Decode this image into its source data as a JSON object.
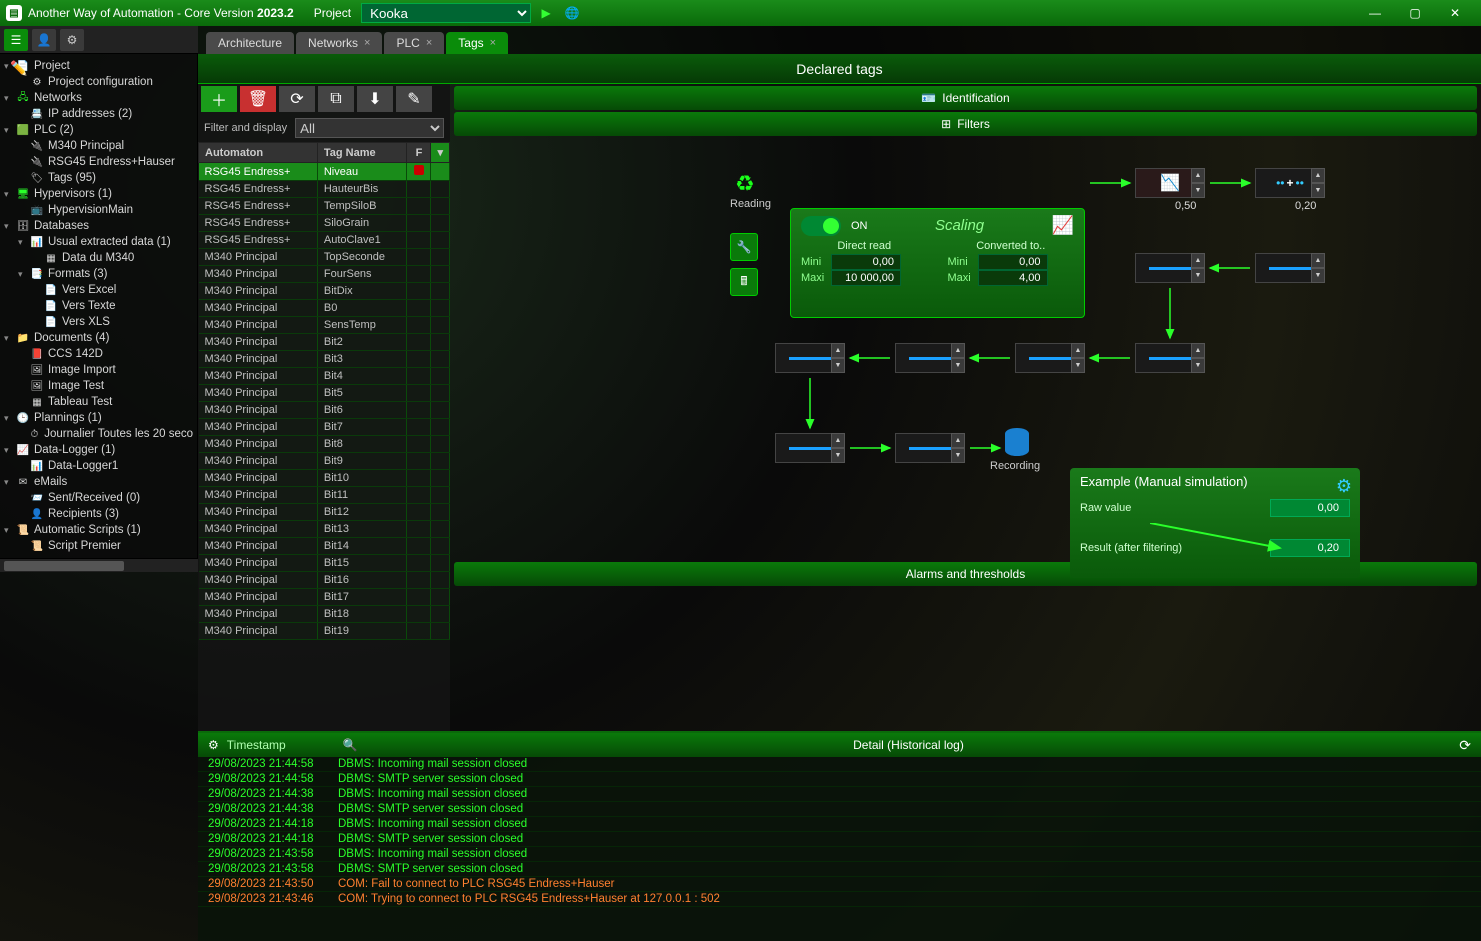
{
  "app": {
    "title_prefix": "Another Way of Automation - Core Version",
    "version": "2023.2",
    "project_label": "Project",
    "project_selected": "Kooka"
  },
  "tabs": [
    {
      "label": "Architecture",
      "closable": false,
      "active": false
    },
    {
      "label": "Networks",
      "closable": true,
      "active": false
    },
    {
      "label": "PLC",
      "closable": true,
      "active": false
    },
    {
      "label": "Tags",
      "closable": true,
      "active": true
    }
  ],
  "tree": [
    {
      "label": "Project",
      "icon": "📄",
      "indent": 0,
      "toggle": "▾"
    },
    {
      "label": "Project configuration",
      "icon": "⚙",
      "indent": 1
    },
    {
      "label": "Networks",
      "icon": "🖧",
      "indent": 0,
      "toggle": "▾",
      "iconColor": "#2aff2a"
    },
    {
      "label": "IP addresses (2)",
      "icon": "📇",
      "indent": 1
    },
    {
      "label": "PLC (2)",
      "icon": "🟩",
      "indent": 0,
      "toggle": "▾"
    },
    {
      "label": "M340 Principal",
      "icon": "🔌",
      "indent": 1
    },
    {
      "label": "RSG45 Endress+Hauser",
      "icon": "🔌",
      "indent": 1
    },
    {
      "label": "Tags (95)",
      "icon": "🏷",
      "indent": 1
    },
    {
      "label": "Hypervisors (1)",
      "icon": "🖥",
      "indent": 0,
      "toggle": "▾",
      "iconColor": "#2aff2a"
    },
    {
      "label": "HypervisionMain",
      "icon": "📺",
      "indent": 1
    },
    {
      "label": "Databases",
      "icon": "🗄",
      "indent": 0,
      "toggle": "▾"
    },
    {
      "label": "Usual extracted data (1)",
      "icon": "📊",
      "indent": 1,
      "toggle": "▾"
    },
    {
      "label": "Data du M340",
      "icon": "▦",
      "indent": 2
    },
    {
      "label": "Formats (3)",
      "icon": "📑",
      "indent": 1,
      "toggle": "▾"
    },
    {
      "label": "Vers Excel",
      "icon": "📄",
      "indent": 2
    },
    {
      "label": "Vers Texte",
      "icon": "📄",
      "indent": 2
    },
    {
      "label": "Vers XLS",
      "icon": "📄",
      "indent": 2
    },
    {
      "label": "Documents (4)",
      "icon": "📁",
      "indent": 0,
      "toggle": "▾",
      "iconColor": "#e8a030"
    },
    {
      "label": "CCS 142D",
      "icon": "📕",
      "indent": 1
    },
    {
      "label": "Image Import",
      "icon": "🖼",
      "indent": 1
    },
    {
      "label": "Image Test",
      "icon": "🖼",
      "indent": 1
    },
    {
      "label": "Tableau Test",
      "icon": "▦",
      "indent": 1
    },
    {
      "label": "Plannings (1)",
      "icon": "🕒",
      "indent": 0,
      "toggle": "▾"
    },
    {
      "label": "Journalier Toutes les 20 seco",
      "icon": "⏱",
      "indent": 1
    },
    {
      "label": "Data-Logger (1)",
      "icon": "📈",
      "indent": 0,
      "toggle": "▾"
    },
    {
      "label": "Data-Logger1",
      "icon": "📊",
      "indent": 1
    },
    {
      "label": "eMails",
      "icon": "✉",
      "indent": 0,
      "toggle": "▾"
    },
    {
      "label": "Sent/Received (0)",
      "icon": "📨",
      "indent": 1
    },
    {
      "label": "Recipients (3)",
      "icon": "👤",
      "indent": 1
    },
    {
      "label": "Automatic Scripts (1)",
      "icon": "📜",
      "indent": 0,
      "toggle": "▾"
    },
    {
      "label": "Script Premier",
      "icon": "📜",
      "indent": 1,
      "iconColor": "#2aff2a"
    }
  ],
  "tags_panel": {
    "title": "Declared tags",
    "filter_label": "Filter and display",
    "filter_value": "All",
    "columns": {
      "automaton": "Automaton",
      "tagname": "Tag Name",
      "flag": "F"
    },
    "rows": [
      {
        "a": "RSG45 Endress+",
        "t": "Niveau",
        "sel": true,
        "flag": true
      },
      {
        "a": "RSG45 Endress+",
        "t": "HauteurBis"
      },
      {
        "a": "RSG45 Endress+",
        "t": "TempSiloB"
      },
      {
        "a": "RSG45 Endress+",
        "t": "SiloGrain"
      },
      {
        "a": "RSG45 Endress+",
        "t": "AutoClave1"
      },
      {
        "a": "M340 Principal",
        "t": "TopSeconde"
      },
      {
        "a": "M340 Principal",
        "t": "FourSens"
      },
      {
        "a": "M340 Principal",
        "t": "BitDix"
      },
      {
        "a": "M340 Principal",
        "t": "B0"
      },
      {
        "a": "M340 Principal",
        "t": "SensTemp"
      },
      {
        "a": "M340 Principal",
        "t": "Bit2"
      },
      {
        "a": "M340 Principal",
        "t": "Bit3"
      },
      {
        "a": "M340 Principal",
        "t": "Bit4"
      },
      {
        "a": "M340 Principal",
        "t": "Bit5"
      },
      {
        "a": "M340 Principal",
        "t": "Bit6"
      },
      {
        "a": "M340 Principal",
        "t": "Bit7"
      },
      {
        "a": "M340 Principal",
        "t": "Bit8"
      },
      {
        "a": "M340 Principal",
        "t": "Bit9"
      },
      {
        "a": "M340 Principal",
        "t": "Bit10"
      },
      {
        "a": "M340 Principal",
        "t": "Bit11"
      },
      {
        "a": "M340 Principal",
        "t": "Bit12"
      },
      {
        "a": "M340 Principal",
        "t": "Bit13"
      },
      {
        "a": "M340 Principal",
        "t": "Bit14"
      },
      {
        "a": "M340 Principal",
        "t": "Bit15"
      },
      {
        "a": "M340 Principal",
        "t": "Bit16"
      },
      {
        "a": "M340 Principal",
        "t": "Bit17"
      },
      {
        "a": "M340 Principal",
        "t": "Bit18"
      },
      {
        "a": "M340 Principal",
        "t": "Bit19"
      }
    ]
  },
  "sections": {
    "identification": "Identification",
    "filters": "Filters",
    "alarms": "Alarms and thresholds"
  },
  "reading_label": "Reading",
  "recording_label": "Recording",
  "scaling": {
    "title": "Scaling",
    "state": "ON",
    "direct_label": "Direct read",
    "converted_label": "Converted to..",
    "mini_label": "Mini",
    "maxi_label": "Maxi",
    "direct_mini": "0,00",
    "direct_maxi": "10 000,00",
    "conv_mini": "0,00",
    "conv_maxi": "4,00"
  },
  "node_values": {
    "v1": "0,50",
    "v2": "0,20"
  },
  "example": {
    "title": "Example (Manual simulation)",
    "raw_label": "Raw value",
    "raw_value": "0,00",
    "result_label": "Result (after filtering)",
    "result_value": "0,20"
  },
  "log": {
    "ts_header": "Timestamp",
    "detail_header": "Detail (Historical log)",
    "rows": [
      {
        "ts": "29/08/2023 21:44:58",
        "msg": "DBMS: Incoming mail session closed",
        "cls": "dbms"
      },
      {
        "ts": "29/08/2023 21:44:58",
        "msg": "DBMS: SMTP server session closed",
        "cls": "dbms"
      },
      {
        "ts": "29/08/2023 21:44:38",
        "msg": "DBMS: Incoming mail session closed",
        "cls": "dbms"
      },
      {
        "ts": "29/08/2023 21:44:38",
        "msg": "DBMS: SMTP server session closed",
        "cls": "dbms"
      },
      {
        "ts": "29/08/2023 21:44:18",
        "msg": "DBMS: Incoming mail session closed",
        "cls": "dbms"
      },
      {
        "ts": "29/08/2023 21:44:18",
        "msg": "DBMS: SMTP server session closed",
        "cls": "dbms"
      },
      {
        "ts": "29/08/2023 21:43:58",
        "msg": "DBMS: Incoming mail session closed",
        "cls": "dbms"
      },
      {
        "ts": "29/08/2023 21:43:58",
        "msg": "DBMS: SMTP server session closed",
        "cls": "dbms"
      },
      {
        "ts": "29/08/2023 21:43:50",
        "msg": "COM: Fail to connect to PLC RSG45 Endress+Hauser",
        "cls": "comerr"
      },
      {
        "ts": "29/08/2023 21:43:46",
        "msg": "COM: Trying to connect to PLC RSG45 Endress+Hauser at 127.0.0.1 : 502",
        "cls": "comerr"
      }
    ]
  }
}
